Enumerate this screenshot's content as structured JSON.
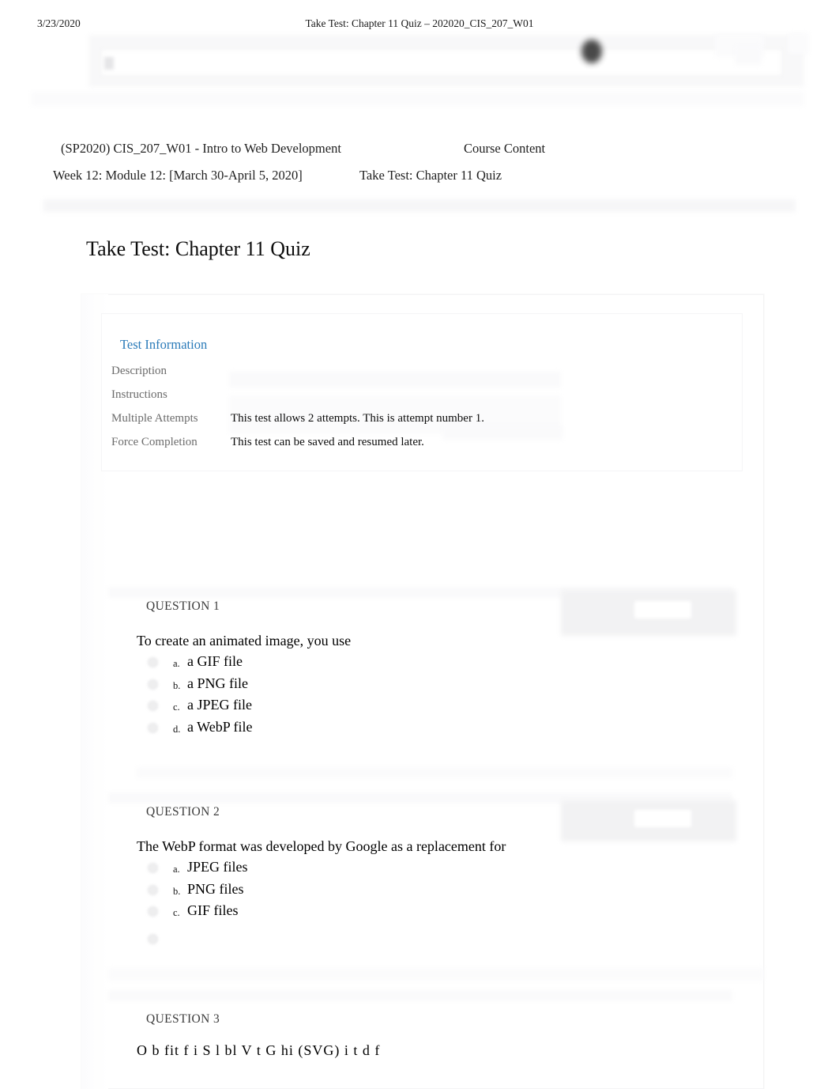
{
  "print_header": {
    "date": "3/23/2020",
    "title": "Take Test: Chapter 11 Quiz – 202020_CIS_207_W01"
  },
  "breadcrumb": {
    "course": "(SP2020) CIS_207_W01 - Intro to Web Development",
    "course_content": "Course Content",
    "module": "Week 12: Module 12: [March 30-April 5, 2020]",
    "current": "Take Test: Chapter 11 Quiz"
  },
  "page_title": "Take Test: Chapter 11 Quiz",
  "test_information": {
    "heading": "Test Information",
    "rows": [
      {
        "label": "Description",
        "value": ""
      },
      {
        "label": "Instructions",
        "value": ""
      },
      {
        "label": "Multiple Attempts",
        "value": "This test allows 2 attempts. This is attempt number 1."
      },
      {
        "label": "Force Completion",
        "value": "This test can be saved and resumed later."
      }
    ]
  },
  "questions": [
    {
      "label": "QUESTION 1",
      "text": "To create an animated image, you use",
      "options": [
        {
          "letter": "a.",
          "text": "a GIF file"
        },
        {
          "letter": "b.",
          "text": "a PNG file"
        },
        {
          "letter": "c.",
          "text": "a JPEG file"
        },
        {
          "letter": "d.",
          "text": "a WebP file"
        }
      ]
    },
    {
      "label": "QUESTION 2",
      "text": "The WebP format was developed by Google as a replacement for",
      "options": [
        {
          "letter": "a.",
          "text": "JPEG files"
        },
        {
          "letter": "b.",
          "text": "PNG files"
        },
        {
          "letter": "c.",
          "text": "GIF files"
        },
        {
          "letter": "",
          "text": ""
        }
      ]
    },
    {
      "label": "QUESTION 3",
      "text": "O   b    fit  f    i    S   l bl  V   t    G    hi   (SVG) i   t   d   f",
      "options": []
    }
  ],
  "colors": {
    "accent_blue": "#2b7bb9",
    "label_gray": "#6b6b6b",
    "question_label_gray": "#3b3b3b",
    "body_black": "#000000",
    "page_background": "#ffffff"
  }
}
